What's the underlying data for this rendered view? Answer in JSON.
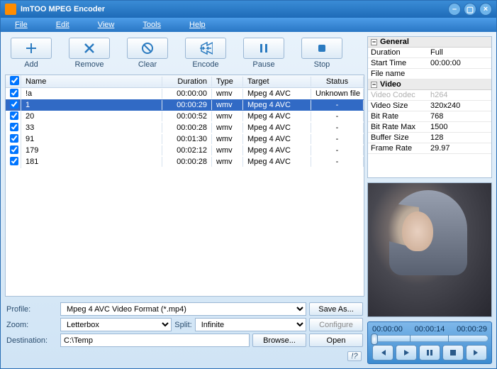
{
  "title": "ImTOO MPEG Encoder",
  "menu": {
    "file": "File",
    "edit": "Edit",
    "view": "View",
    "tools": "Tools",
    "help": "Help"
  },
  "toolbar": {
    "add": "Add",
    "remove": "Remove",
    "clear": "Clear",
    "encode": "Encode",
    "pause": "Pause",
    "stop": "Stop"
  },
  "columns": {
    "name": "Name",
    "duration": "Duration",
    "type": "Type",
    "target": "Target",
    "status": "Status"
  },
  "rows": [
    {
      "checked": true,
      "name": "!a",
      "duration": "00:00:00",
      "type": "wmv",
      "target": "Mpeg 4 AVC",
      "status": "Unknown file"
    },
    {
      "checked": true,
      "name": "1",
      "duration": "00:00:29",
      "type": "wmv",
      "target": "Mpeg 4 AVC",
      "status": "-",
      "selected": true
    },
    {
      "checked": true,
      "name": "20",
      "duration": "00:00:52",
      "type": "wmv",
      "target": "Mpeg 4 AVC",
      "status": "-"
    },
    {
      "checked": true,
      "name": "33",
      "duration": "00:00:28",
      "type": "wmv",
      "target": "Mpeg 4 AVC",
      "status": "-"
    },
    {
      "checked": true,
      "name": "91",
      "duration": "00:01:30",
      "type": "wmv",
      "target": "Mpeg 4 AVC",
      "status": "-"
    },
    {
      "checked": true,
      "name": "179",
      "duration": "00:02:12",
      "type": "wmv",
      "target": "Mpeg 4 AVC",
      "status": "-"
    },
    {
      "checked": true,
      "name": "181",
      "duration": "00:00:28",
      "type": "wmv",
      "target": "Mpeg 4 AVC",
      "status": "-"
    }
  ],
  "bottom": {
    "profile_lbl": "Profile:",
    "profile_val": "Mpeg 4 AVC Video Format  (*.mp4)",
    "save_as": "Save As...",
    "zoom_lbl": "Zoom:",
    "zoom_val": "Letterbox",
    "split_lbl": "Split:",
    "split_val": "Infinite",
    "configure": "Configure",
    "dest_lbl": "Destination:",
    "dest_val": "C:\\Temp",
    "browse": "Browse...",
    "open": "Open",
    "help_icon": "!?"
  },
  "props": {
    "general": {
      "header": "General",
      "rows": [
        {
          "key": "Duration",
          "val": "Full"
        },
        {
          "key": "Start Time",
          "val": "00:00:00"
        },
        {
          "key": "File name",
          "val": ""
        }
      ]
    },
    "video": {
      "header": "Video",
      "rows": [
        {
          "key": "Video Codec",
          "val": "h264",
          "dim": true
        },
        {
          "key": "Video Size",
          "val": "320x240"
        },
        {
          "key": "Bit Rate",
          "val": "768"
        },
        {
          "key": "Bit Rate Max",
          "val": "1500"
        },
        {
          "key": "Buffer Size",
          "val": "128"
        },
        {
          "key": "Frame Rate",
          "val": "29.97"
        }
      ]
    }
  },
  "player": {
    "t0": "00:00:00",
    "t1": "00:00:14",
    "t2": "00:00:29"
  }
}
